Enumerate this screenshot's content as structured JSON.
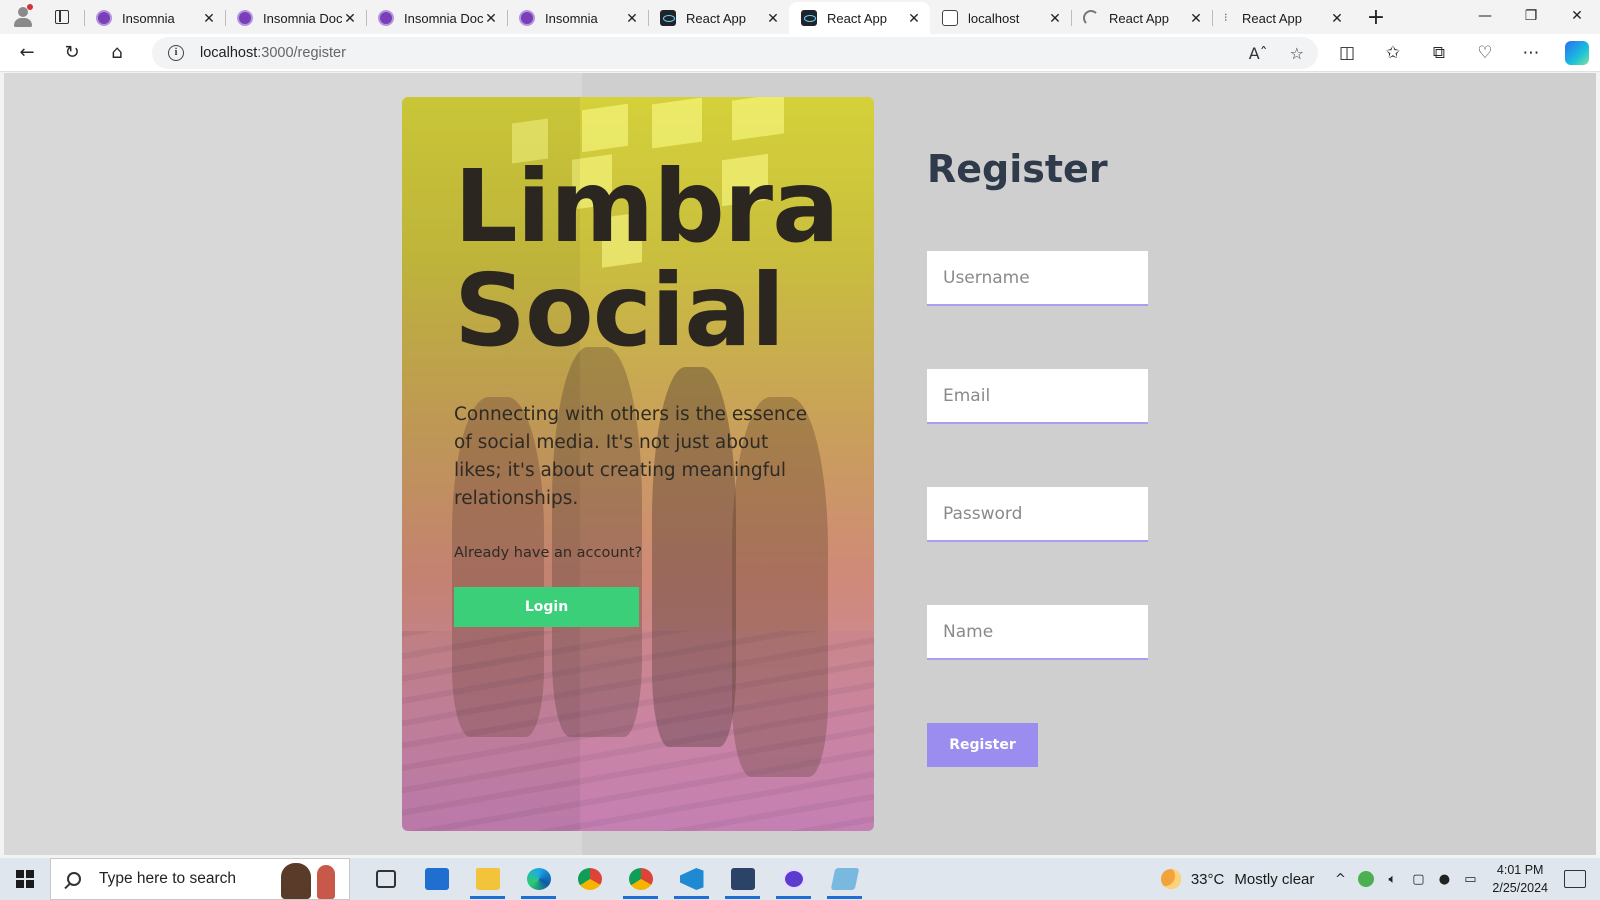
{
  "browser": {
    "tabs": [
      {
        "title": "Insomnia",
        "favicon": "insomnia-icon",
        "active": false
      },
      {
        "title": "Insomnia Doc",
        "favicon": "insomnia-icon",
        "active": false
      },
      {
        "title": "Insomnia Doc",
        "favicon": "insomnia-icon",
        "active": false
      },
      {
        "title": "Insomnia",
        "favicon": "insomnia-icon",
        "active": false
      },
      {
        "title": "React App",
        "favicon": "react-icon",
        "active": false
      },
      {
        "title": "React App",
        "favicon": "react-icon",
        "active": true
      },
      {
        "title": "localhost",
        "favicon": "localhost-icon",
        "active": false
      },
      {
        "title": "React App",
        "favicon": "loading-icon",
        "active": false
      },
      {
        "title": "React App",
        "favicon": "loading-icon",
        "active": false
      }
    ],
    "url_host": "localhost",
    "url_path": ":3000/register"
  },
  "hero": {
    "title_line1": "Limbra",
    "title_line2": "Social",
    "description": "Connecting with others is the essence of social media. It's not just about likes; it's about creating meaningful relationships.",
    "question": "Already have an account?",
    "login_label": "Login"
  },
  "register": {
    "title": "Register",
    "username_placeholder": "Username",
    "email_placeholder": "Email",
    "password_placeholder": "Password",
    "name_placeholder": "Name",
    "submit_label": "Register",
    "accent_color": "#9b8df0"
  },
  "taskbar": {
    "search_placeholder": "Type here to search",
    "weather_temp": "33°C",
    "weather_condition": "Mostly clear",
    "time": "4:01 PM",
    "date": "2/25/2024"
  }
}
